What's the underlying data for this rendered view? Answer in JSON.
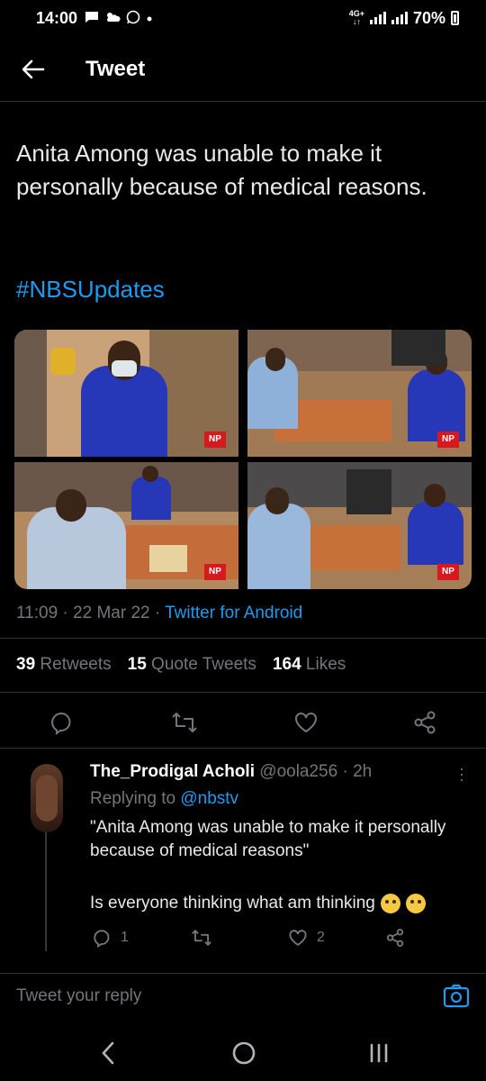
{
  "status_bar": {
    "time": "14:00",
    "network_type": "4G+",
    "battery": "70%"
  },
  "header": {
    "title": "Tweet"
  },
  "tweet": {
    "text": "Anita Among was unable to make it personally because of medical reasons.",
    "hashtag": "#NBSUpdates",
    "media_watermark": "NP",
    "time": "11:09",
    "date": "22 Mar 22",
    "source": "Twitter for Android",
    "stats": {
      "retweets_count": "39",
      "retweets_label": "Retweets",
      "quotes_count": "15",
      "quotes_label": "Quote Tweets",
      "likes_count": "164",
      "likes_label": "Likes"
    }
  },
  "reply": {
    "name": "The_Prodigal Acholi",
    "handle": "@oola256",
    "age": "2h",
    "replying_prefix": "Replying to",
    "replying_to": "@nbstv",
    "text1": "\"Anita Among was unable to make it personally because of medical reasons\"",
    "text2": "Is everyone thinking what am thinking",
    "reply_count": "1",
    "like_count": "2"
  },
  "composer": {
    "placeholder": "Tweet your reply"
  },
  "colors": {
    "accent": "#1d9bf0",
    "muted": "#71767b",
    "background": "#000000"
  }
}
